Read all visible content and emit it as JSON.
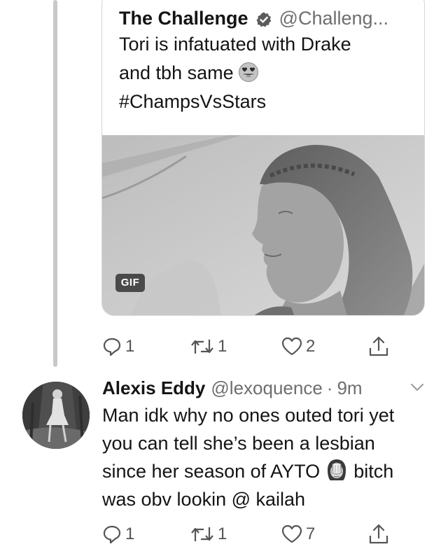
{
  "quoted_tweet": {
    "name": "The Challenge",
    "verified_icon": "verified-badge-icon",
    "handle": "@Challeng...",
    "text_lines": [
      "Tori is infatuated with Drake",
      "and tbh same",
      "#ChampsVsStars"
    ],
    "emoji": "heart-eyes-emoji",
    "media_badge": "GIF",
    "actions": {
      "reply_count": "1",
      "retweet_count": "1",
      "like_count": "2"
    }
  },
  "reply_tweet": {
    "name": "Alexis Eddy",
    "handle": "@lexoquence",
    "separator": "·",
    "time": "9m",
    "text_lines": [
      "Man idk why no ones outed tori yet",
      "you can tell she’s been a lesbian",
      "since her season of AYTO",
      "bitch",
      "was obv lookin @ kailah"
    ],
    "emoji": "woman-facepalming-emoji",
    "actions": {
      "reply_count": "1",
      "retweet_count": "1",
      "like_count": "7"
    }
  },
  "colors": {
    "text": "#141414",
    "muted": "#6e6e6e",
    "border": "#d6d6d6",
    "thread_line": "#c9c9c9"
  }
}
